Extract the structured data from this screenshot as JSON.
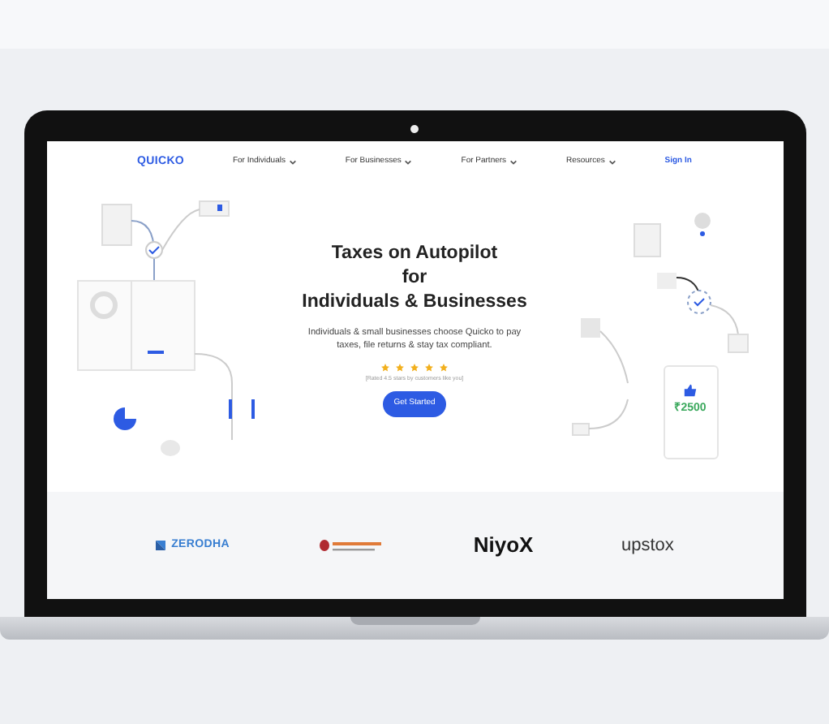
{
  "brand": "QUICKO",
  "nav": [
    {
      "label": "For Individuals",
      "caret": true
    },
    {
      "label": "For Businesses",
      "caret": true
    },
    {
      "label": "For Partners",
      "caret": true
    },
    {
      "label": "Resources",
      "caret": true
    },
    {
      "label": "Sign In",
      "caret": false
    }
  ],
  "hero": {
    "title_lines": [
      "Taxes on Autopilot",
      "for",
      "Individuals & Businesses"
    ],
    "subtitle": "Individuals & small businesses choose Quicko to pay taxes, file returns & stay tax compliant.",
    "stars": 5,
    "rating_note": "[Rated 4.5 stars by customers like you]",
    "cta": "Get Started",
    "refund_amount": "₹2500"
  },
  "partners": [
    {
      "kind": "zerodha",
      "name": "ZERODHA"
    },
    {
      "kind": "icici"
    },
    {
      "kind": "niyo",
      "name": "NiyoX"
    },
    {
      "kind": "upstox",
      "name": "upstox"
    }
  ]
}
